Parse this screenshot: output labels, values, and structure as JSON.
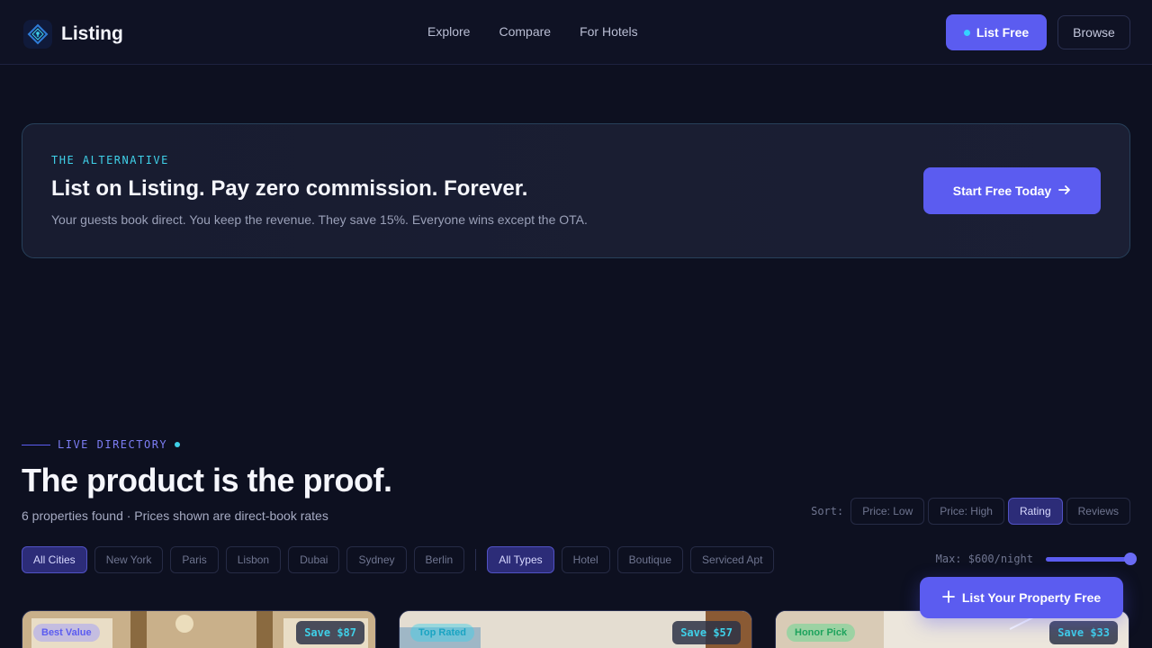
{
  "header": {
    "brand": "Listing",
    "nav": [
      {
        "label": "Explore"
      },
      {
        "label": "Compare"
      },
      {
        "label": "For Hotels"
      }
    ],
    "list_free_label": "List Free",
    "browse_label": "Browse"
  },
  "promo": {
    "eyebrow": "THE ALTERNATIVE",
    "title": "List on Listing. Pay zero commission. Forever.",
    "subtitle": "Your guests book direct. You keep the revenue. They save 15%. Everyone wins except the OTA.",
    "cta_label": "Start Free Today",
    "cta_icon": "arrow-right-icon"
  },
  "directory": {
    "eyebrow": "LIVE DIRECTORY",
    "title": "The product is the proof.",
    "subtitle": "6 properties found · Prices shown are direct-book rates",
    "sort": {
      "label": "Sort:",
      "options": [
        "Price: Low",
        "Price: High",
        "Rating",
        "Reviews"
      ],
      "selected": "Rating"
    },
    "cities": {
      "options": [
        "All Cities",
        "New York",
        "Paris",
        "Lisbon",
        "Dubai",
        "Sydney",
        "Berlin"
      ],
      "selected": "All Cities"
    },
    "types": {
      "options": [
        "All Types",
        "Hotel",
        "Boutique",
        "Serviced Apt"
      ],
      "selected": "All Types"
    },
    "max_price": {
      "label": "Max: $600/night",
      "fraction": 1.0
    }
  },
  "fab_label": "List Your Property Free",
  "cards": [
    {
      "badge": "Best Value",
      "save": "Save $87"
    },
    {
      "badge": "Top Rated",
      "save": "Save $57"
    },
    {
      "badge": "Honor Pick",
      "save": "Save $33"
    }
  ],
  "colors": {
    "accent": "#5b5cf0",
    "cyan": "#3fd0e8",
    "background": "#0d1020"
  }
}
